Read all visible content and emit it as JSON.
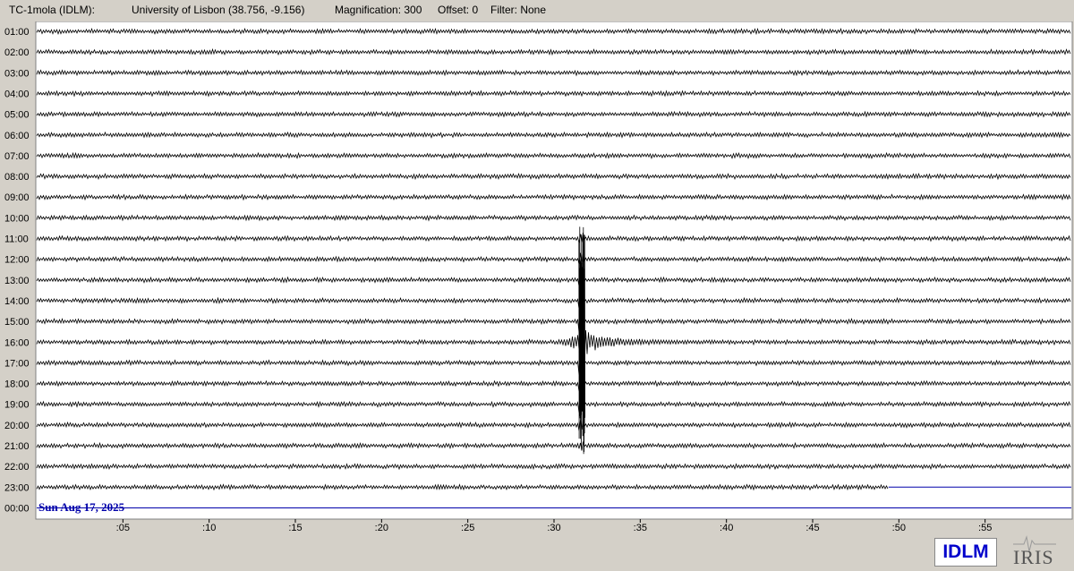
{
  "header": {
    "station": "TC-1mola (IDLM):",
    "location": "University of Lisbon (38.756, -9.156)",
    "magnification": "Magnification: 300",
    "offset": "Offset: 0",
    "filter": "Filter: None"
  },
  "chart_data": {
    "type": "line",
    "description_type": "helicorder",
    "date_label": "Sun Aug 17, 2025",
    "row_labels": [
      "01:00",
      "02:00",
      "03:00",
      "04:00",
      "05:00",
      "06:00",
      "07:00",
      "08:00",
      "09:00",
      "10:00",
      "11:00",
      "12:00",
      "13:00",
      "14:00",
      "15:00",
      "16:00",
      "17:00",
      "18:00",
      "19:00",
      "20:00",
      "21:00",
      "22:00",
      "23:00",
      "00:00"
    ],
    "x_ticks": [
      ":05",
      ":10",
      ":15",
      ":20",
      ":25",
      ":30",
      ":35",
      ":40",
      ":45",
      ":50",
      ":55"
    ],
    "x_tick_values": [
      5,
      10,
      15,
      20,
      25,
      30,
      35,
      40,
      45,
      50,
      55
    ],
    "xlim": [
      0,
      60
    ],
    "trace_color": "#000000",
    "current_color": "#0000aa",
    "event": {
      "row": "16:00",
      "minute": 31.6,
      "peak_rows_up": 5.6,
      "peak_rows_down": 5.4,
      "coda_end_minute": 41
    },
    "trace_end": {
      "row": "23:00",
      "minute": 49.4
    }
  },
  "logos": {
    "idlm": "IDLM",
    "iris": "IRIS"
  }
}
